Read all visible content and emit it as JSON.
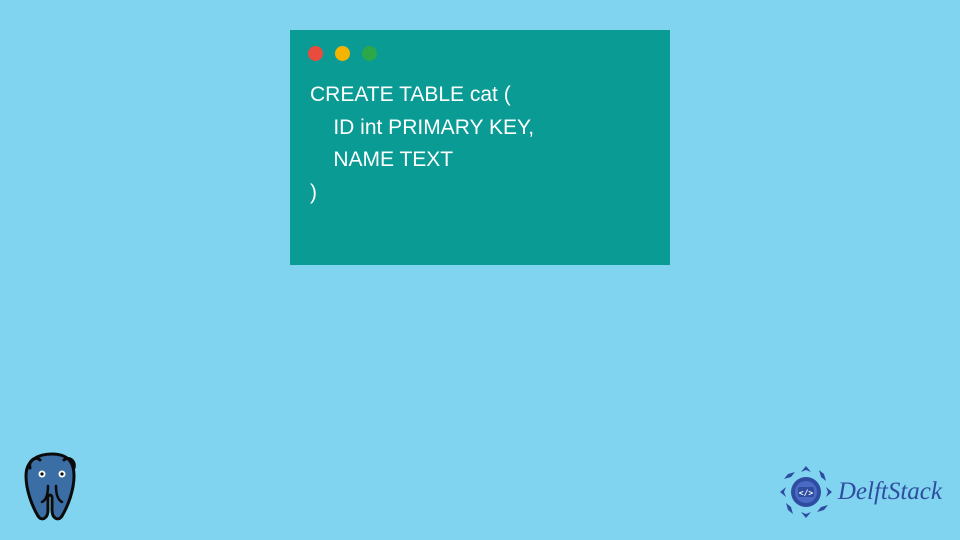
{
  "colors": {
    "background": "#81d4f0",
    "window": "#0a9b94",
    "code_text": "#ffffff",
    "dot_red": "#e94b3c",
    "dot_yellow": "#f5b400",
    "dot_green": "#2ba84a",
    "brand_blue": "#2f4da0",
    "pg_body": "#3b6ea5",
    "pg_outline": "#0b0b0b"
  },
  "code": {
    "line1": "CREATE TABLE cat (",
    "line2": "    ID int PRIMARY KEY,",
    "line3": "    NAME TEXT",
    "line4": ")"
  },
  "brand": {
    "name": "DelftStack",
    "badge_inner": "</>"
  },
  "icons": {
    "bottom_left": "postgresql-elephant-logo",
    "bottom_right": "delftstack-logo"
  }
}
